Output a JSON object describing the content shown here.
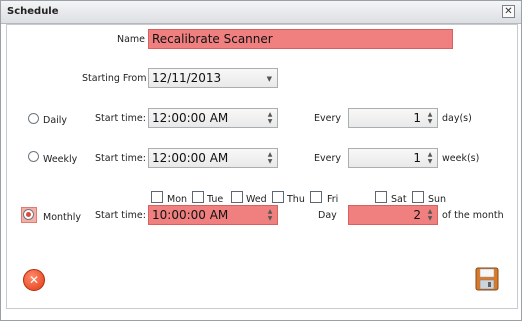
{
  "window": {
    "title": "Schedule",
    "close_glyph": "✕"
  },
  "form": {
    "name_label": "Name",
    "name_value": "Recalibrate Scanner",
    "starting_from_label": "Starting From",
    "starting_from_value": "12/11/2013",
    "daily": {
      "label": "Daily",
      "start_time_label": "Start time:",
      "start_time_value": "12:00:00 AM",
      "every_label": "Every",
      "every_value": "1",
      "unit_label": "day(s)",
      "selected": false
    },
    "weekly": {
      "label": "Weekly",
      "start_time_label": "Start time:",
      "start_time_value": "12:00:00 AM",
      "every_label": "Every",
      "every_value": "1",
      "unit_label": "week(s)",
      "selected": false,
      "days": [
        "Mon",
        "Tue",
        "Wed",
        "Thu",
        "Fri",
        "Sat",
        "Sun"
      ]
    },
    "monthly": {
      "label": "Monthly",
      "start_time_label": "Start time:",
      "start_time_value": "10:00:00 AM",
      "day_label": "Day",
      "day_value": "2",
      "unit_label": "of the month",
      "selected": true
    }
  },
  "icons": {
    "cancel": "cancel-icon",
    "save": "floppy-disk-icon",
    "dropdown": "chevron-down-icon",
    "spinner": "up-down-arrows-icon"
  },
  "colors": {
    "highlight_field": "#f08080",
    "cancel_button": "#e23b16",
    "radio_selected": "#d94b3b"
  }
}
